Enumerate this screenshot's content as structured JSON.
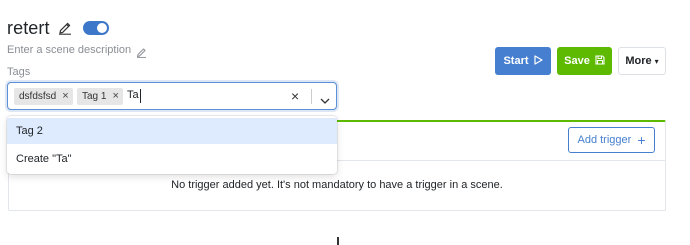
{
  "scene": {
    "title": "retert",
    "description_placeholder": "Enter a scene description",
    "enabled": true
  },
  "tags": {
    "label": "Tags",
    "selected": [
      {
        "label": "dsfdsfsd",
        "remove_glyph": "×"
      },
      {
        "label": "Tag 1",
        "remove_glyph": "×"
      }
    ],
    "input_value": "Ta",
    "clear_glyph": "×",
    "options": [
      {
        "label": "Tag 2",
        "highlighted": true
      },
      {
        "label": "Create \"Ta\"",
        "highlighted": false
      }
    ]
  },
  "toolbar": {
    "start_label": "Start",
    "save_label": "Save",
    "more_label": "More",
    "more_caret": "▾"
  },
  "triggers": {
    "add_label": "Add trigger",
    "add_glyph": "+",
    "empty_message": "No trigger added yet. It's not mandatory to have a trigger in a scene."
  },
  "colors": {
    "primary": "#467fcf",
    "success": "#5eba00",
    "option_highlight": "#deebff",
    "toggle_on": "#3d77c9"
  },
  "icons": {
    "title_edit": "pencil-icon",
    "description_edit": "pencil-icon",
    "start": "play-icon",
    "save": "floppy-disk-icon",
    "dropdown": "chevron-down-icon",
    "clear": "close-icon"
  }
}
